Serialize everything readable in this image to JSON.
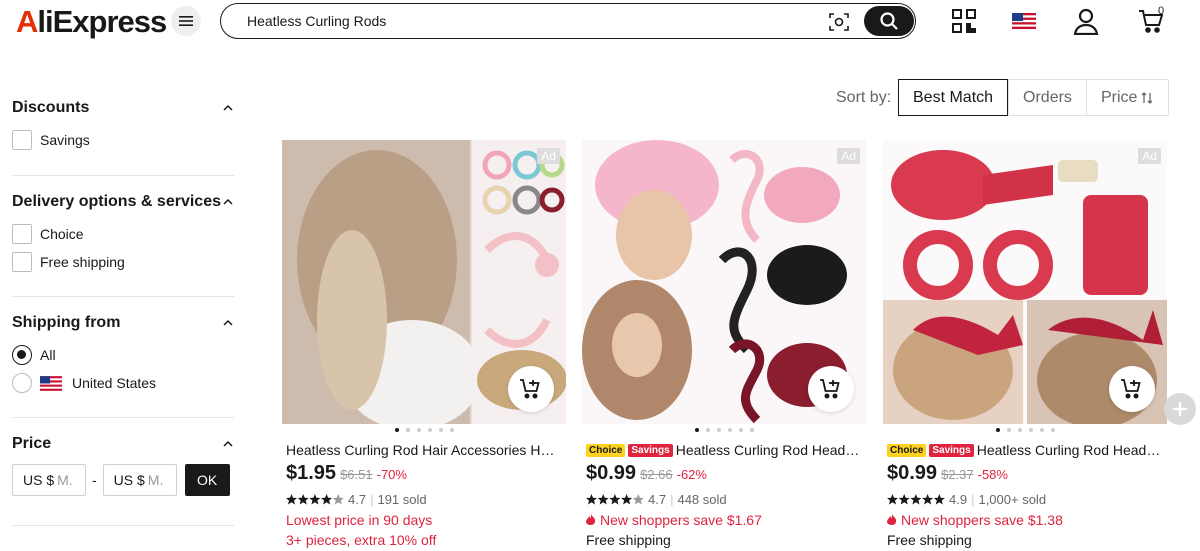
{
  "header": {
    "logo": "AliExpress",
    "search_value": "Heatless Curling Rods",
    "cart_count": "0"
  },
  "sidebar": {
    "discounts": {
      "title": "Discounts",
      "options": [
        "Savings"
      ]
    },
    "delivery": {
      "title": "Delivery options & services",
      "options": [
        "Choice",
        "Free shipping"
      ]
    },
    "shipping_from": {
      "title": "Shipping from",
      "options": [
        "All",
        "United States"
      ],
      "selected": "All"
    },
    "price": {
      "title": "Price",
      "min_prefix": "US $",
      "min_placeholder": "M.",
      "max_prefix": "US $",
      "max_placeholder": "M.",
      "dash": "-",
      "ok": "OK"
    }
  },
  "sort": {
    "label": "Sort by:",
    "options": [
      "Best Match",
      "Orders",
      "Price"
    ],
    "active": "Best Match"
  },
  "products": [
    {
      "ad": "Ad",
      "title": "Heatless Curling Rod Hair Accessories Hair Curler",
      "price": "$1.95",
      "original_price": "$6.51",
      "discount": "-70%",
      "rating": "4.7",
      "sold": "191 sold",
      "promo1": "Lowest price in 90 days",
      "promo2": "3+ pieces, extra 10% off"
    },
    {
      "ad": "Ad",
      "choice": "Choice",
      "savings": "Savings",
      "title": "Heatless Curling Rod Headband",
      "price": "$0.99",
      "original_price": "$2.66",
      "discount": "-62%",
      "rating": "4.7",
      "sold": "448 sold",
      "promo1": "New shoppers save $1.67",
      "shipping": "Free shipping"
    },
    {
      "ad": "Ad",
      "choice": "Choice",
      "savings": "Savings",
      "title": "Heatless Curling Rod Headband",
      "price": "$0.99",
      "original_price": "$2.37",
      "discount": "-58%",
      "rating": "4.9",
      "sold": "1,000+ sold",
      "promo1": "New shoppers save $1.38",
      "shipping": "Free shipping"
    }
  ],
  "colors": {
    "accent_red": "#e0243e",
    "choice_yellow": "#fcd21e",
    "brand_red": "#e62e04"
  }
}
